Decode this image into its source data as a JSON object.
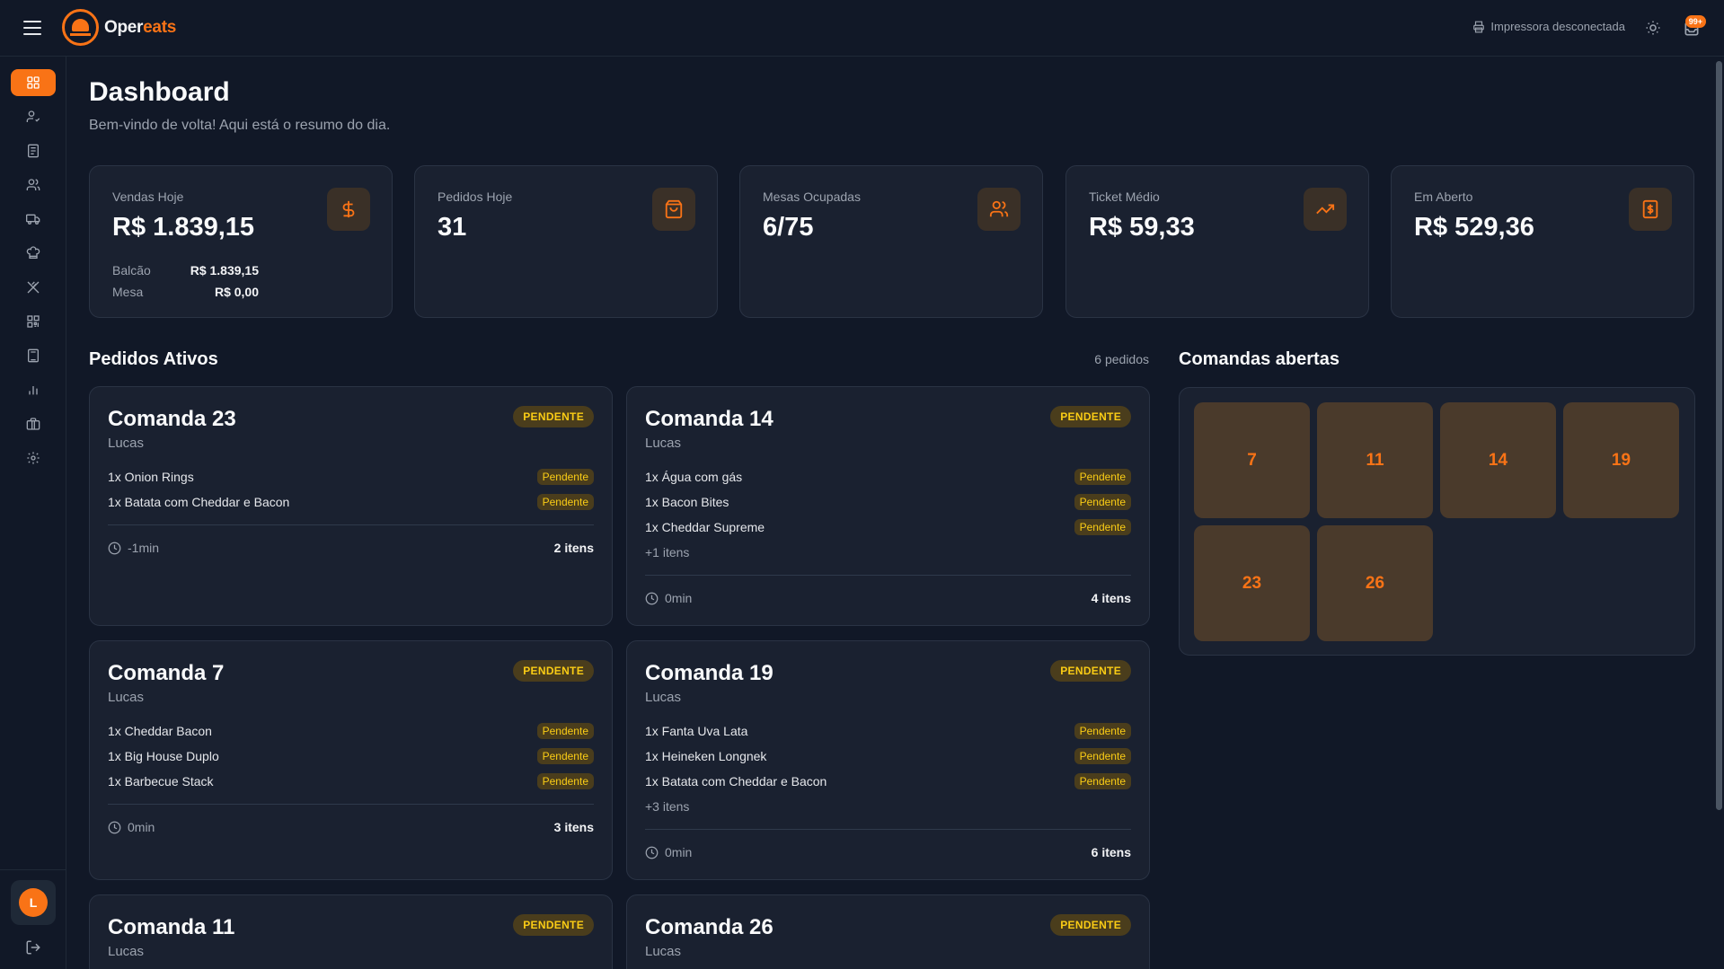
{
  "app": {
    "brand_part1": "Oper",
    "brand_part2": "eats",
    "printer_status": "Impressora desconectada",
    "notifications_badge": "99+",
    "accent_color": "#f97316"
  },
  "sidebar": {
    "items": [
      {
        "icon": "dashboard-grid-icon",
        "active": true
      },
      {
        "icon": "user-check-icon"
      },
      {
        "icon": "receipt-icon"
      },
      {
        "icon": "users-icon"
      },
      {
        "icon": "delivery-truck-icon"
      },
      {
        "icon": "chef-hat-icon"
      },
      {
        "icon": "utensils-crossed-icon"
      },
      {
        "icon": "qr-code-icon"
      },
      {
        "icon": "calculator-icon"
      },
      {
        "icon": "bar-chart-icon"
      },
      {
        "icon": "briefcase-icon"
      },
      {
        "icon": "settings-gear-icon"
      }
    ],
    "user_initial": "L"
  },
  "header": {
    "title": "Dashboard",
    "subtitle": "Bem-vindo de volta! Aqui está o resumo do dia."
  },
  "stats": [
    {
      "label": "Vendas Hoje",
      "value": "R$ 1.839,15",
      "icon": "dollar-sign-icon",
      "breakdown": [
        {
          "k": "Balcão",
          "v": "R$ 1.839,15"
        },
        {
          "k": "Mesa",
          "v": "R$ 0,00"
        }
      ]
    },
    {
      "label": "Pedidos Hoje",
      "value": "31",
      "icon": "shopping-bag-icon"
    },
    {
      "label": "Mesas Ocupadas",
      "value": "6/75",
      "icon": "users-icon"
    },
    {
      "label": "Ticket Médio",
      "value": "R$ 59,33",
      "icon": "trending-up-icon"
    },
    {
      "label": "Em Aberto",
      "value": "R$ 529,36",
      "icon": "receipt-dollar-icon"
    }
  ],
  "active_orders": {
    "title": "Pedidos Ativos",
    "count_label": "6 pedidos",
    "orders": [
      {
        "title": "Comanda 23",
        "user": "Lucas",
        "status": "PENDENTE",
        "items": [
          {
            "name": "1x Onion Rings",
            "status": "Pendente"
          },
          {
            "name": "1x Batata com Cheddar e Bacon",
            "status": "Pendente"
          }
        ],
        "more": "",
        "time": "-1min",
        "count": "2 itens"
      },
      {
        "title": "Comanda 14",
        "user": "Lucas",
        "status": "PENDENTE",
        "items": [
          {
            "name": "1x Água com gás",
            "status": "Pendente"
          },
          {
            "name": "1x Bacon Bites",
            "status": "Pendente"
          },
          {
            "name": "1x Cheddar Supreme",
            "status": "Pendente"
          }
        ],
        "more": "+1 itens",
        "time": "0min",
        "count": "4 itens"
      },
      {
        "title": "Comanda 7",
        "user": "Lucas",
        "status": "PENDENTE",
        "items": [
          {
            "name": "1x Cheddar Bacon",
            "status": "Pendente"
          },
          {
            "name": "1x Big House Duplo",
            "status": "Pendente"
          },
          {
            "name": "1x Barbecue Stack",
            "status": "Pendente"
          }
        ],
        "more": "",
        "time": "0min",
        "count": "3 itens"
      },
      {
        "title": "Comanda 19",
        "user": "Lucas",
        "status": "PENDENTE",
        "items": [
          {
            "name": "1x Fanta Uva Lata",
            "status": "Pendente"
          },
          {
            "name": "1x Heineken Longnek",
            "status": "Pendente"
          },
          {
            "name": "1x Batata com Cheddar e Bacon",
            "status": "Pendente"
          }
        ],
        "more": "+3 itens",
        "time": "0min",
        "count": "6 itens"
      },
      {
        "title": "Comanda 11",
        "user": "Lucas",
        "status": "PENDENTE",
        "items": [],
        "more": "",
        "time": "",
        "count": ""
      },
      {
        "title": "Comanda 26",
        "user": "Lucas",
        "status": "PENDENTE",
        "items": [],
        "more": "",
        "time": "",
        "count": ""
      }
    ]
  },
  "open_tabs": {
    "title": "Comandas abertas",
    "numbers": [
      "7",
      "11",
      "14",
      "19",
      "23",
      "26"
    ]
  }
}
